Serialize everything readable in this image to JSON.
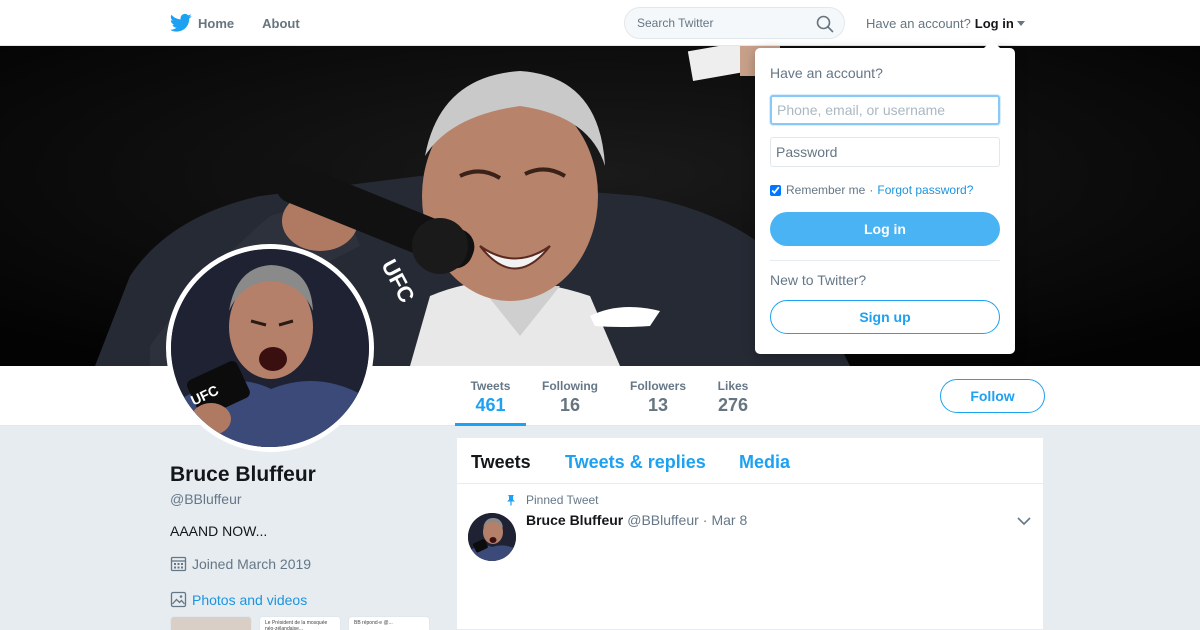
{
  "nav": {
    "home_label": "Home",
    "about_label": "About",
    "search_placeholder": "Search Twitter",
    "have_account_text": "Have an account?",
    "login_label": "Log in"
  },
  "colors": {
    "brand_blue": "#1da1f2",
    "login_button": "#4ab3f4",
    "link_blue": "#1b95e0",
    "page_bg": "#e6ecf0"
  },
  "profile": {
    "name": "Bruce Bluffeur",
    "handle": "@BBluffeur",
    "bio": "AAAND NOW...",
    "joined": "Joined March 2019",
    "photos_label": "Photos and videos",
    "thumbnails": [
      {
        "text": ""
      },
      {
        "text": "Le Président de la mosquée néo-zélandaise..."
      },
      {
        "text": "BB répond·e @..."
      }
    ]
  },
  "stats": [
    {
      "label": "Tweets",
      "value": "461",
      "active": true
    },
    {
      "label": "Following",
      "value": "16",
      "active": false
    },
    {
      "label": "Followers",
      "value": "13",
      "active": false
    },
    {
      "label": "Likes",
      "value": "276",
      "active": false
    }
  ],
  "follow_label": "Follow",
  "timeline": {
    "tabs": [
      "Tweets",
      "Tweets & replies",
      "Media"
    ],
    "active_tab": "Tweets",
    "pinned_label": "Pinned Tweet",
    "tweet": {
      "name": "Bruce Bluffeur",
      "handle": "@BBluffeur",
      "separator": "·",
      "date": "Mar 8"
    }
  },
  "login_dropdown": {
    "title": "Have an account?",
    "username_placeholder": "Phone, email, or username",
    "password_placeholder": "Password",
    "remember_label": "Remember me",
    "separator": "·",
    "forgot_label": "Forgot password?",
    "login_button": "Log in",
    "new_text": "New to Twitter?",
    "signup_button": "Sign up"
  },
  "icons": {
    "logo": "twitter-bird-icon",
    "search": "search-icon",
    "calendar": "calendar-icon",
    "photos": "image-icon",
    "pin": "pin-icon",
    "tweet_menu": "chevron-down-icon"
  }
}
